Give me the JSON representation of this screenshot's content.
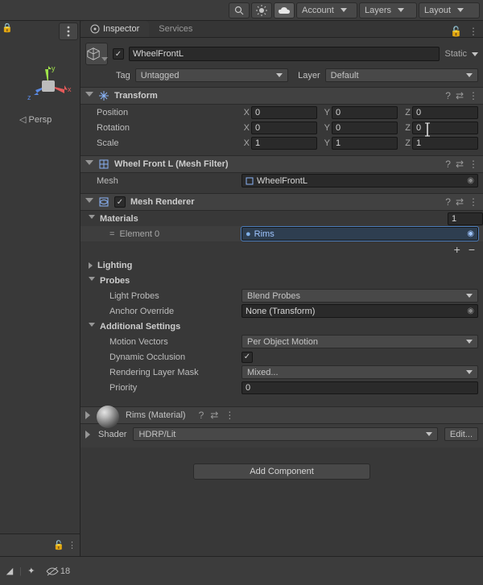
{
  "toolbar": {
    "account": "Account",
    "layers": "Layers",
    "layout": "Layout"
  },
  "tabs": {
    "inspector": "Inspector",
    "services": "Services"
  },
  "object": {
    "name": "WheelFrontL",
    "static": "Static"
  },
  "tagrow": {
    "tagLabel": "Tag",
    "tagValue": "Untagged",
    "layerLabel": "Layer",
    "layerValue": "Default"
  },
  "transform": {
    "title": "Transform",
    "position": {
      "label": "Position",
      "x": "0",
      "y": "0",
      "z": "0"
    },
    "rotation": {
      "label": "Rotation",
      "x": "0",
      "y": "0",
      "z": "0"
    },
    "scale": {
      "label": "Scale",
      "x": "1",
      "y": "1",
      "z": "1"
    },
    "axis": {
      "x": "X",
      "y": "Y",
      "z": "Z"
    }
  },
  "meshFilter": {
    "title": "Wheel Front L (Mesh Filter)",
    "meshLabel": "Mesh",
    "meshValue": "WheelFrontL"
  },
  "meshRenderer": {
    "title": "Mesh Renderer",
    "materials": "Materials",
    "materialsCount": "1",
    "element0": "Element 0",
    "element0Value": "Rims",
    "lighting": "Lighting",
    "probes": "Probes",
    "lightProbes": "Light Probes",
    "lightProbesValue": "Blend Probes",
    "anchorOverride": "Anchor Override",
    "anchorOverrideValue": "None (Transform)",
    "additional": "Additional Settings",
    "motionVectors": "Motion Vectors",
    "motionVectorsValue": "Per Object Motion",
    "dynamicOcclusion": "Dynamic Occlusion",
    "renderingLayerMask": "Rendering Layer Mask",
    "renderingLayerMaskValue": "Mixed...",
    "priority": "Priority",
    "priorityValue": "0"
  },
  "material": {
    "title": "Rims (Material)",
    "shaderLabel": "Shader",
    "shaderValue": "HDRP/Lit",
    "edit": "Edit..."
  },
  "addComponent": "Add Component",
  "persp": "Persp",
  "visibleCount": "18"
}
